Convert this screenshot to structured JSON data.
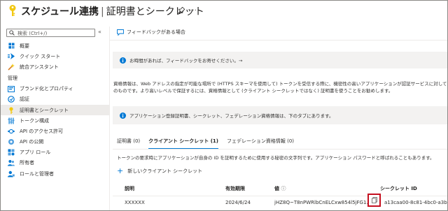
{
  "header": {
    "app_title": "スケジュール連携",
    "separator": "|",
    "page_title": "証明書とシークレット",
    "more": "…"
  },
  "sidebar": {
    "search_placeholder": "検索 (Ctrl+/)",
    "collapse": "«",
    "items_top": [
      {
        "label": "概要",
        "icon": "overview-icon"
      },
      {
        "label": "クイック スタート",
        "icon": "quickstart-icon"
      },
      {
        "label": "統合アシスタント",
        "icon": "integration-assistant-icon"
      }
    ],
    "section_manage": "管理",
    "items_manage": [
      {
        "label": "ブランド化とプロパティ",
        "icon": "branding-icon"
      },
      {
        "label": "認証",
        "icon": "authentication-icon"
      },
      {
        "label": "証明書とシークレット",
        "icon": "key-icon",
        "active": true
      },
      {
        "label": "トークン構成",
        "icon": "token-config-icon"
      },
      {
        "label": "API のアクセス許可",
        "icon": "api-permissions-icon"
      },
      {
        "label": "API の公開",
        "icon": "expose-api-icon"
      },
      {
        "label": "アプリ ロール",
        "icon": "app-roles-icon"
      },
      {
        "label": "所有者",
        "icon": "owners-icon"
      },
      {
        "label": "ロールと管理者",
        "icon": "roles-admins-icon"
      }
    ]
  },
  "main": {
    "feedback_link": "フィードバックがある場合",
    "feedback_banner": "お時間があれば、フィードバックをお寄せください。→",
    "description_line1": "資格情報は、Web アドレスの指定が可能な場所で (HTTPS スキーマを使用して) トークンを受信する際に、機密性の高いアプリケーションが認証サービスに対して自身を識別でき",
    "description_line2": "のものです。より高いレベルで保証するには、資格情報として (クライアント シークレットではなく) 証明書を使うことをお勧めします。",
    "app_banner": "アプリケーション登録証明書、シークレット、フェデレーション資格情報は、下のタブにあります。",
    "tabs": [
      {
        "label": "証明書 (0)",
        "active": false
      },
      {
        "label": "クライアント シークレット (1)",
        "active": true
      },
      {
        "label": "フェデレーション資格情報 (0)",
        "active": false
      }
    ],
    "tab_description": "トークンの要求時にアプリケーションが自身の ID を証明するために使用する秘密の文字列です。アプリケーション パスワードと呼ばれることもあります。",
    "new_secret": "新しいクライアント シークレット",
    "table": {
      "headers": [
        "説明",
        "有効期限",
        "値",
        "シークレット ID"
      ],
      "value_header_info": "ⓘ",
      "rows": [
        {
          "description": "XXXXXX",
          "expires": "2024/6/24",
          "value": "jHZ8Q~T8nPWRlbCnELCxw854l5jFG1...",
          "secret_id": "a13caa00-8c81-4bc0-a3b0-3f..."
        }
      ]
    }
  },
  "colors": {
    "accent": "#0078d4",
    "highlight_box": "#c50f1f",
    "key_icon": "#f2c811"
  }
}
